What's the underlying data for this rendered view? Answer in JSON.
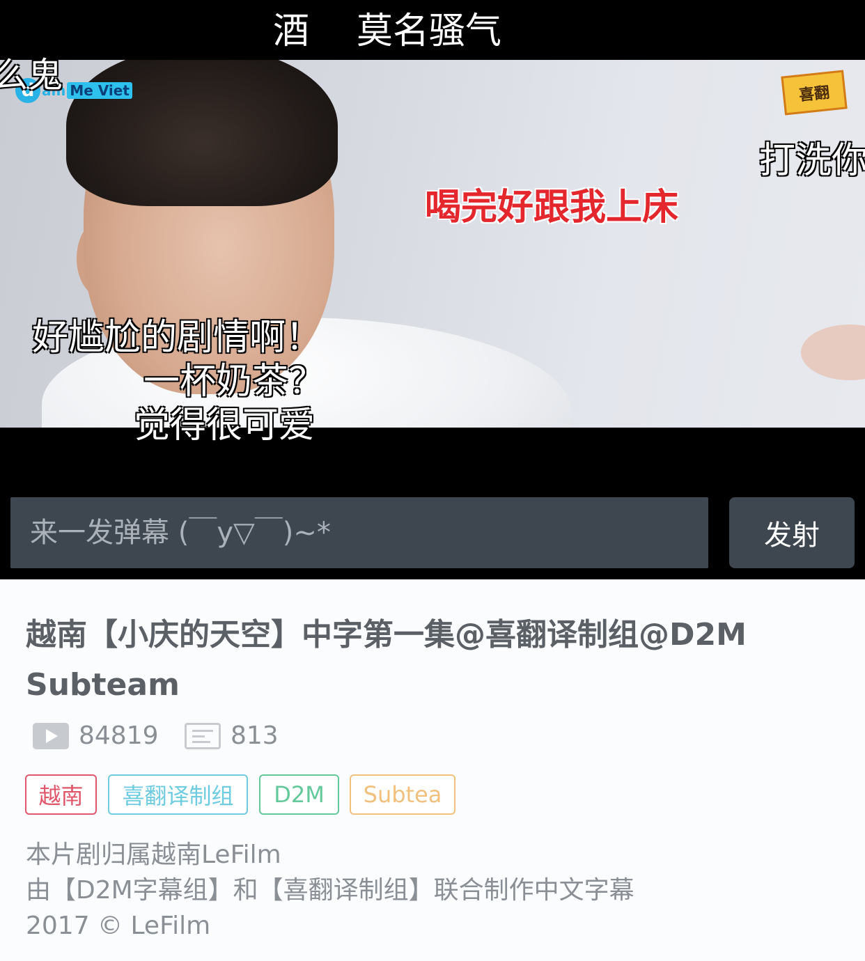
{
  "danmaku": {
    "top_left": "酒",
    "top_center": "莫名骚气",
    "left_edge": "么鬼",
    "right_edge": "打洗你",
    "red_comment": "喝完好跟我上床",
    "lower_1": "好尴尬的剧情啊！",
    "lower_2": "一杯奶茶？",
    "lower_3": "觉得很可爱"
  },
  "watermarks": {
    "d2m_letter": "d",
    "d2m_text": "am",
    "d2m_viet": "Me Viet",
    "xifan": "喜翻"
  },
  "comment_bar": {
    "placeholder": "来一发弹幕 (￣y▽￣)~*",
    "send_label": "发射"
  },
  "video": {
    "title": "越南【小庆的天空】中字第一集@喜翻译制组@D2M Subteam",
    "play_count": "84819",
    "danmaku_count": "813"
  },
  "tags": [
    {
      "label": "越南",
      "color": "#e0566b"
    },
    {
      "label": "喜翻译制组",
      "color": "#6fcbe0"
    },
    {
      "label": "D2M",
      "color": "#63c99a"
    },
    {
      "label": "Subtea",
      "color": "#f0c07c"
    }
  ],
  "description": [
    "本片剧归属越南LeFilm",
    "由【D2M字幕组】和【喜翻译制组】联合制作中文字幕",
    "2017 © LeFilm"
  ]
}
